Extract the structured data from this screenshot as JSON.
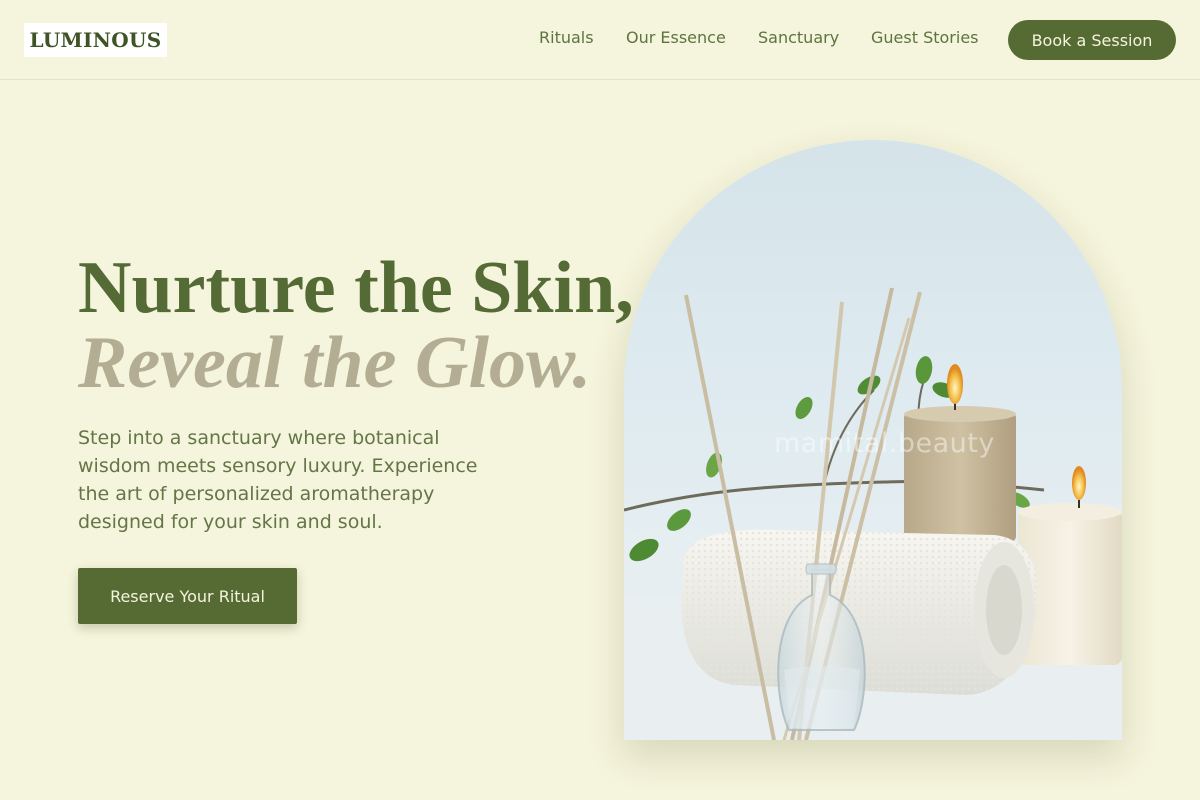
{
  "brand": {
    "name": "LUMINOUS"
  },
  "nav": {
    "items": [
      {
        "label": "Rituals"
      },
      {
        "label": "Our Essence"
      },
      {
        "label": "Sanctuary"
      },
      {
        "label": "Guest Stories"
      }
    ],
    "book_label": "Book a Session"
  },
  "hero": {
    "headline": "Nurture the Skin,",
    "subline": "Reveal the Glow.",
    "description": "Step into a sanctuary where botanical wisdom meets sensory luxury. Experience the art of personalized aromatherapy designed for your skin and soul.",
    "cta_label": "Reserve Your Ritual"
  },
  "image": {
    "watermark": "mamital.beauty",
    "subject": "reed diffuser, rolled towel, candles and green leaves"
  },
  "colors": {
    "background": "#f5f4dc",
    "accent": "#566b34",
    "subline": "#b3ad93",
    "text": "#647648"
  }
}
